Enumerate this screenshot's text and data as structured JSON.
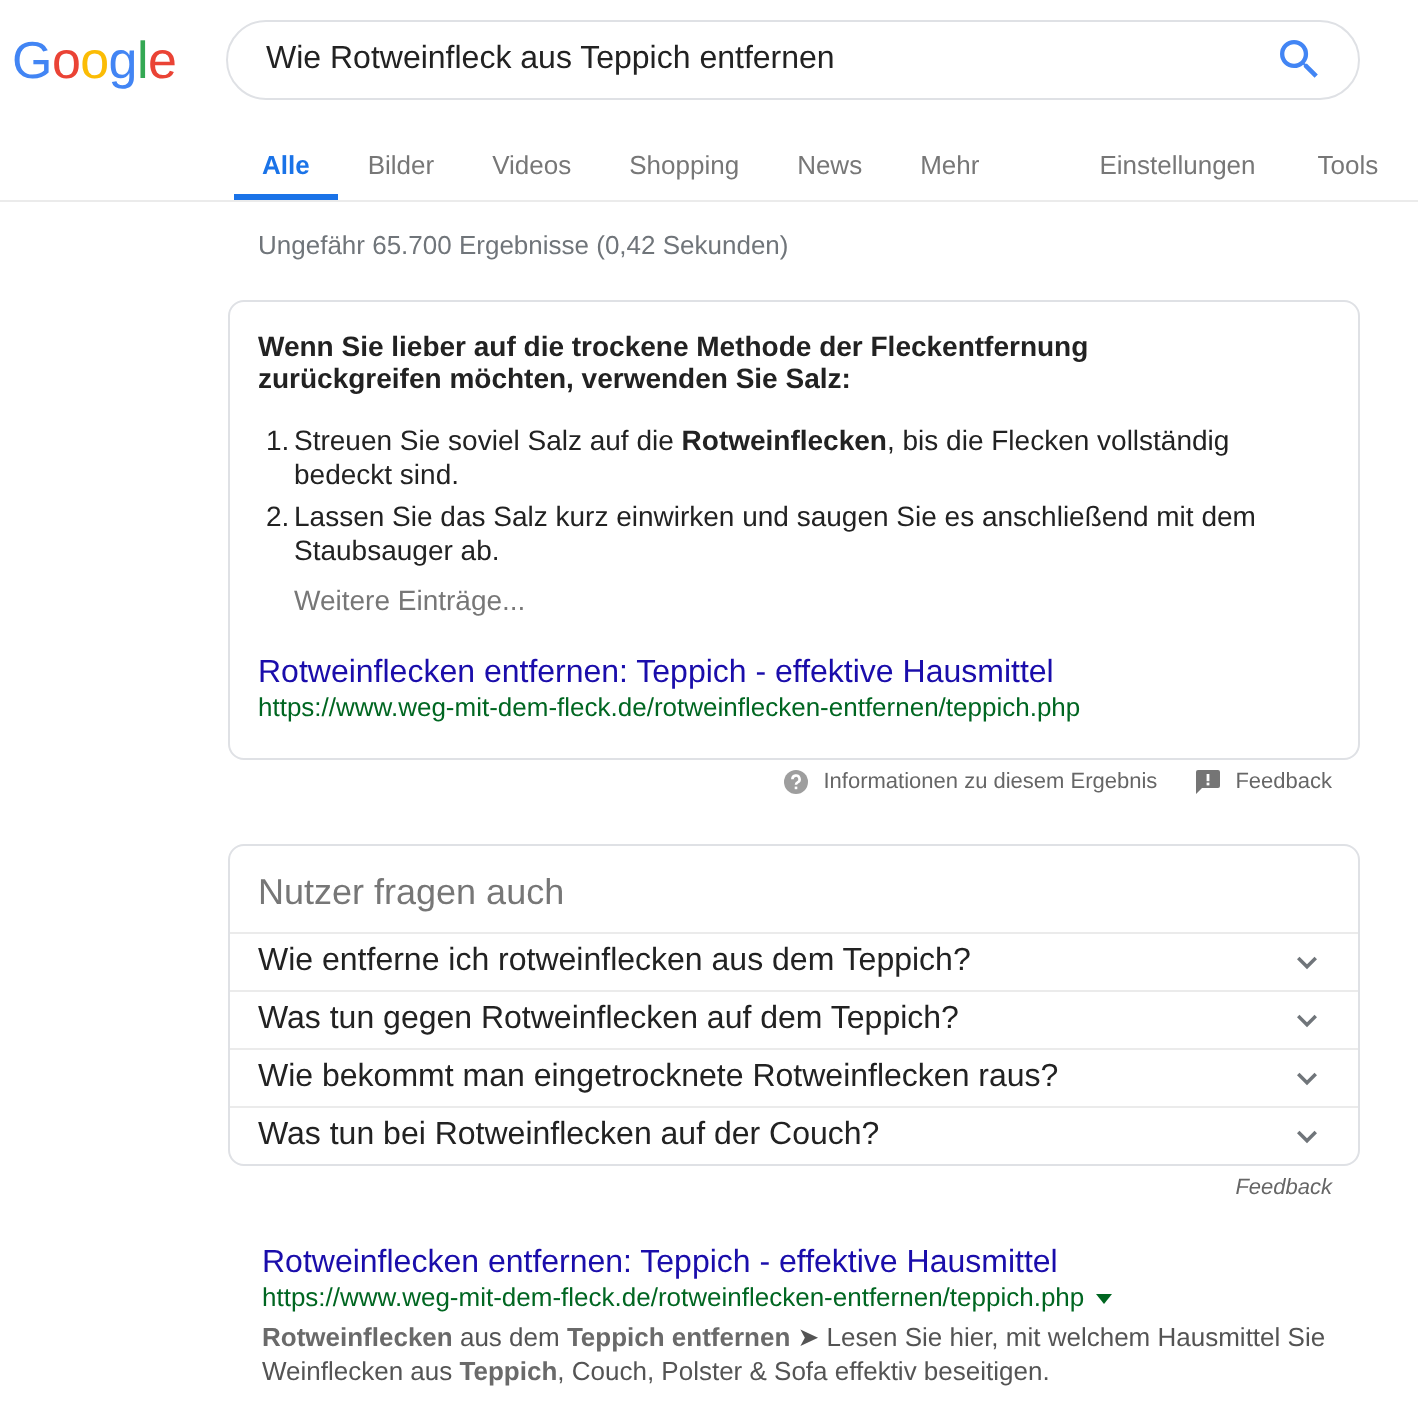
{
  "logo": {
    "text": "Google"
  },
  "search": {
    "value": "Wie Rotweinfleck aus Teppich entfernen"
  },
  "tabs": [
    {
      "label": "Alle",
      "selected": true
    },
    {
      "label": "Bilder",
      "selected": false
    },
    {
      "label": "Videos",
      "selected": false
    },
    {
      "label": "Shopping",
      "selected": false
    },
    {
      "label": "News",
      "selected": false
    },
    {
      "label": "Mehr",
      "selected": false
    }
  ],
  "tool_links": [
    "Einstellungen",
    "Tools"
  ],
  "result_stats": "Ungefähr 65.700 Ergebnisse (0,42 Sekunden)",
  "featured_snippet": {
    "heading": "Wenn Sie lieber auf die trockene Methode der Fleckentfernung zurückgreifen möchten, verwenden Sie Salz:",
    "steps": [
      {
        "number": "1.",
        "text": "Streuen Sie soviel Salz auf die **Rotweinflecken**, bis die Flecken vollständig bedeckt sind."
      },
      {
        "number": "2.",
        "text": "Lassen Sie das Salz kurz einwirken und saugen Sie es anschließend mit dem Staubsauger ab."
      }
    ],
    "more_link": "Weitere Einträge...",
    "title": "Rotweinflecken entfernen: Teppich - effektive Hausmittel",
    "url": "https://www.weg-mit-dem-fleck.de/rotweinflecken-entfernen/teppich.php"
  },
  "snippet_footer": {
    "info_link": "Informationen zu diesem Ergebnis",
    "feedback": "Feedback"
  },
  "people_also_ask": {
    "heading": "Nutzer fragen auch",
    "questions": [
      {
        "text": "Wie entferne ich rotweinflecken aus dem Teppich?",
        "expanded": false
      },
      {
        "text": "Was tun gegen Rotweinflecken auf dem Teppich?",
        "expanded": false
      },
      {
        "text": "Wie bekommt man eingetrocknete Rotweinflecken raus?",
        "expanded": false
      },
      {
        "text": "Was tun bei Rotweinflecken auf der Couch?",
        "expanded": false
      }
    ],
    "feedback": "Feedback"
  },
  "results": [
    {
      "title": "Rotweinflecken entfernen: Teppich - effektive Hausmittel",
      "url": "https://www.weg-mit-dem-fleck.de/rotweinflecken-entfernen/teppich.php",
      "snippet": "**Rotweinflecken** aus dem **Teppich entfernen** ➤ Lesen Sie hier, mit welchem Hausmittel Sie Weinflecken aus **Teppich**, Couch, Polster & Sofa effektiv beseitigen."
    }
  ]
}
